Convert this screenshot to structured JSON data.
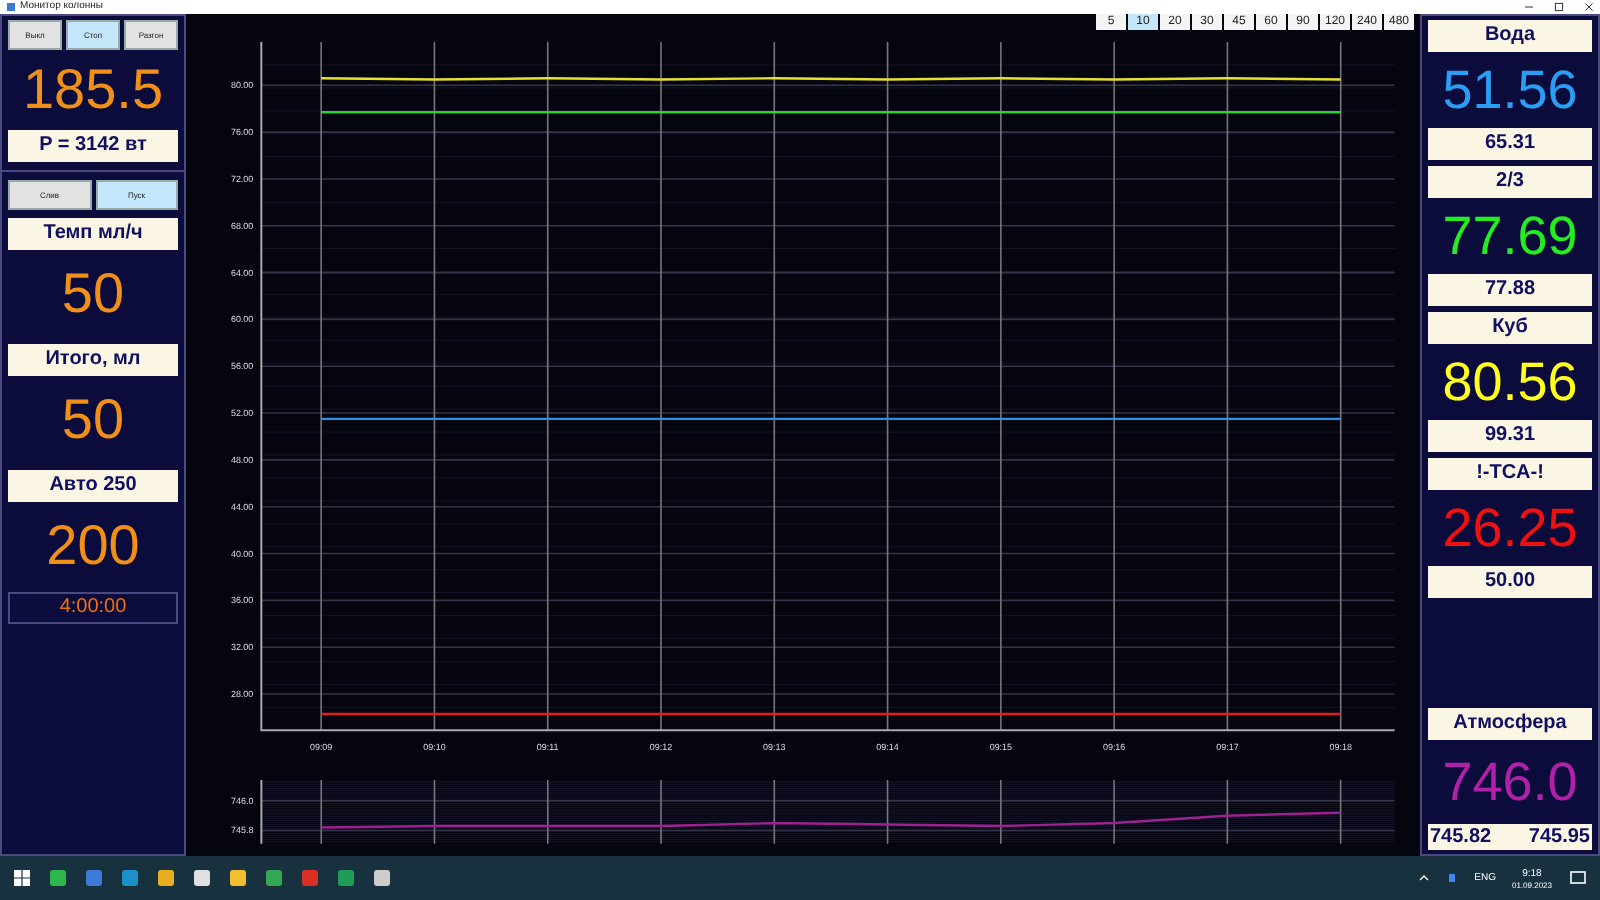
{
  "window": {
    "title": "Монитор колонны"
  },
  "left_panel": {
    "top_buttons": [
      {
        "label": "Выкл",
        "selected": false
      },
      {
        "label": "Стоп",
        "selected": true
      },
      {
        "label": "Разгон",
        "selected": false
      }
    ],
    "power": {
      "value": "185.5",
      "label": "P = 3142 вт"
    },
    "pump_buttons": [
      {
        "label": "Слив",
        "selected": false
      },
      {
        "label": "Пуск",
        "selected": true
      }
    ],
    "readouts": [
      {
        "label": "Темп мл/ч",
        "value": "50"
      },
      {
        "label": "Итого, мл",
        "value": "50"
      },
      {
        "label": "Авто 250",
        "value": "200"
      }
    ],
    "timer": "4:00:00"
  },
  "range_buttons": [
    {
      "label": "5",
      "selected": false
    },
    {
      "label": "10",
      "selected": true
    },
    {
      "label": "20",
      "selected": false
    },
    {
      "label": "30",
      "selected": false
    },
    {
      "label": "45",
      "selected": false
    },
    {
      "label": "60",
      "selected": false
    },
    {
      "label": "90",
      "selected": false
    },
    {
      "label": "120",
      "selected": false
    },
    {
      "label": "240",
      "selected": false
    },
    {
      "label": "480",
      "selected": false
    }
  ],
  "main_chart": {
    "chart_data": {
      "type": "line",
      "grid": true,
      "categories": [
        "09:09",
        "09:10",
        "09:11",
        "09:12",
        "09:13",
        "09:14",
        "09:15",
        "09:16",
        "09:17",
        "09:18"
      ],
      "ylim": [
        24.9,
        83.7
      ],
      "yticks": [
        {
          "value": 28,
          "label": "28.00"
        },
        {
          "value": 32,
          "label": "32.00"
        },
        {
          "value": 36,
          "label": "36.00"
        },
        {
          "value": 40,
          "label": "40.00"
        },
        {
          "value": 44,
          "label": "44.00"
        },
        {
          "value": 48,
          "label": "48.00"
        },
        {
          "value": 52,
          "label": "52.00"
        },
        {
          "value": 56,
          "label": "56.00"
        },
        {
          "value": 60,
          "label": "60.00"
        },
        {
          "value": 64,
          "label": "64.00"
        },
        {
          "value": 68,
          "label": "68.00"
        },
        {
          "value": 72,
          "label": "72.00"
        },
        {
          "value": 76,
          "label": "76.00"
        },
        {
          "value": 80,
          "label": "80.00"
        }
      ],
      "series": [
        {
          "color": "#e8e030",
          "values": [
            80.6,
            80.5,
            80.6,
            80.5,
            80.6,
            80.5,
            80.6,
            80.5,
            80.6,
            80.5
          ]
        },
        {
          "color": "#30d030",
          "values": [
            77.7,
            77.7,
            77.7,
            77.7,
            77.7,
            77.7,
            77.7,
            77.7,
            77.7,
            77.7
          ]
        },
        {
          "color": "#2a8df0",
          "values": [
            51.5,
            51.5,
            51.5,
            51.5,
            51.5,
            51.5,
            51.5,
            51.5,
            51.5,
            51.5
          ]
        },
        {
          "color": "#e02020",
          "values": [
            26.3,
            26.3,
            26.3,
            26.3,
            26.3,
            26.3,
            26.3,
            26.3,
            26.3,
            26.3
          ]
        }
      ]
    }
  },
  "pressure_chart": {
    "chart_data": {
      "type": "line",
      "grid": true,
      "ylim": [
        745.71,
        746.14
      ],
      "yticks": [
        {
          "value": 745.8,
          "label": "745.8"
        },
        {
          "value": 746.0,
          "label": "746.0"
        }
      ],
      "series": [
        {
          "color": "#a02090",
          "values": [
            745.82,
            745.83,
            745.83,
            745.83,
            745.85,
            745.84,
            745.83,
            745.85,
            745.9,
            745.92
          ]
        }
      ]
    }
  },
  "sensors": [
    {
      "name": "Вода",
      "value": "51.56",
      "secondary": "65.31",
      "color": "#2a9df4"
    },
    {
      "name": "2/3",
      "value": "77.69",
      "secondary": "77.88",
      "color": "#22ee22"
    },
    {
      "name": "Куб",
      "value": "80.56",
      "secondary": "99.31",
      "color": "#ffff20"
    },
    {
      "name": "!-TCA-!",
      "value": "26.25",
      "secondary": "50.00",
      "color": "#f01010"
    }
  ],
  "atmosphere": {
    "name": "Атмосфера",
    "value": "746.0",
    "min": "745.82",
    "max": "745.95",
    "color": "#b020a8"
  },
  "taskbar": {
    "language": "ENG",
    "time": "9:18",
    "date": "01.09.2023"
  }
}
